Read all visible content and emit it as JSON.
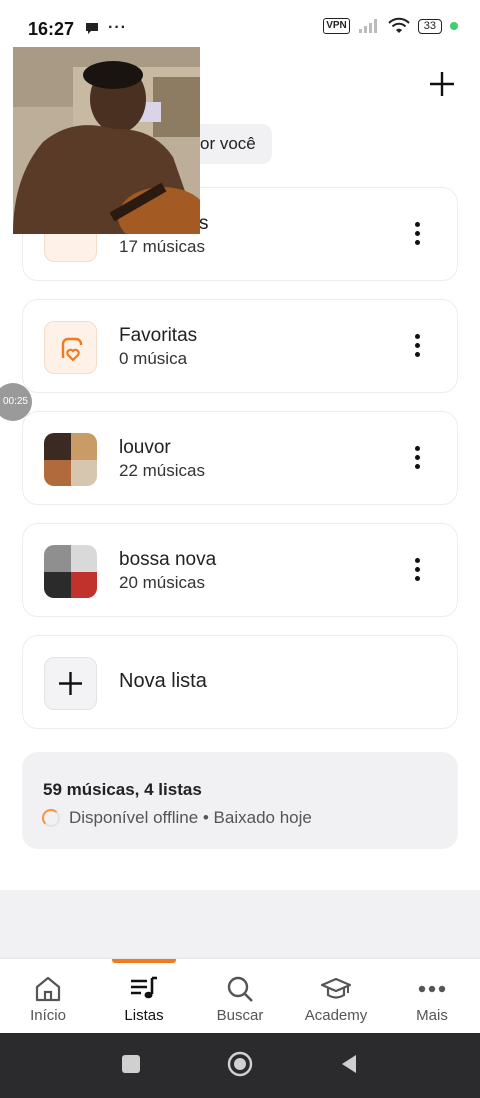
{
  "status_bar": {
    "time": "16:27",
    "vpn": "VPN",
    "battery": "33"
  },
  "header": {
    "chip_text": "or você"
  },
  "recording_timer": "00:25",
  "playlists": [
    {
      "title": "s",
      "subtitle": "17 músicas",
      "thumb": "download-icon"
    },
    {
      "title": "Favoritas",
      "subtitle": "0 música",
      "thumb": "heart-list-icon"
    },
    {
      "title": "louvor",
      "subtitle": "22 músicas",
      "thumb": "cover-mosaic"
    },
    {
      "title": "bossa nova",
      "subtitle": "20 músicas",
      "thumb": "cover-mosaic"
    }
  ],
  "new_list": {
    "label": "Nova lista"
  },
  "summary": {
    "title": "59 músicas, 4 listas",
    "subtitle": "Disponível offline • Baixado hoje"
  },
  "bottom_nav": [
    {
      "label": "Início",
      "icon": "home-icon"
    },
    {
      "label": "Listas",
      "icon": "playlist-icon",
      "active": true
    },
    {
      "label": "Buscar",
      "icon": "search-icon"
    },
    {
      "label": "Academy",
      "icon": "graduation-cap-icon"
    },
    {
      "label": "Mais",
      "icon": "more-icon"
    }
  ],
  "colors": {
    "accent": "#f07a1e",
    "card_border": "#ececee",
    "summary_bg": "#f1f1f3"
  }
}
